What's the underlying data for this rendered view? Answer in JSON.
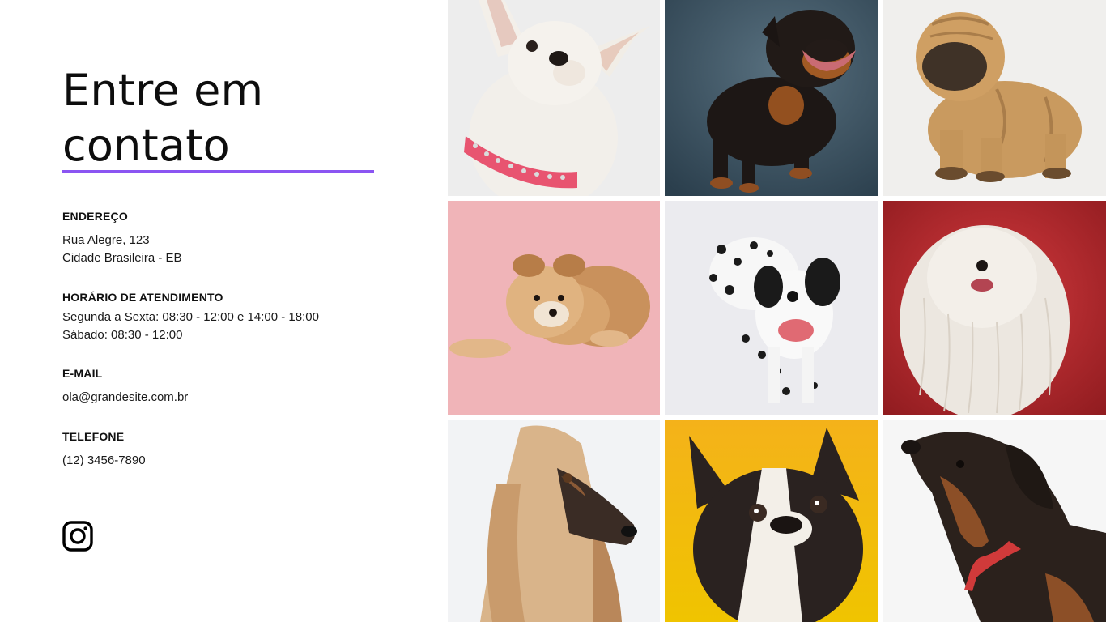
{
  "contact": {
    "title_line1": "Entre em",
    "title_line2": "contato",
    "accent_color": "#8b55f2",
    "address": {
      "heading": "ENDEREÇO",
      "line1": "Rua Alegre, 123",
      "line2": "Cidade Brasileira - EB"
    },
    "hours": {
      "heading": "HORÁRIO DE ATENDIMENTO",
      "line1": "Segunda a Sexta: 08:30 - 12:00 e 14:00 - 18:00",
      "line2": "Sábado: 08:30 - 12:00"
    },
    "email": {
      "heading": "E-MAIL",
      "value": "ola@grandesite.com.br"
    },
    "phone": {
      "heading": "TELEFONE",
      "value": "(12) 3456-7890"
    },
    "social_icon": "instagram-icon"
  },
  "gallery": [
    {
      "name": "chihuahua-photo",
      "background": "#ececec"
    },
    {
      "name": "rottweiler-photo",
      "background": "#3c5566"
    },
    {
      "name": "shar-pei-photo",
      "background": "#f0efed"
    },
    {
      "name": "pomeranian-photo",
      "background": "#f1b5b9"
    },
    {
      "name": "dalmatian-photo",
      "background": "#ebebf0"
    },
    {
      "name": "komondor-photo",
      "background": "#b8282c"
    },
    {
      "name": "afghan-hound-photo",
      "background": "#f3f4f6"
    },
    {
      "name": "french-bulldog-photo",
      "background": "#f2b310"
    },
    {
      "name": "dachshund-photo",
      "background": "#f6f6f6"
    }
  ]
}
